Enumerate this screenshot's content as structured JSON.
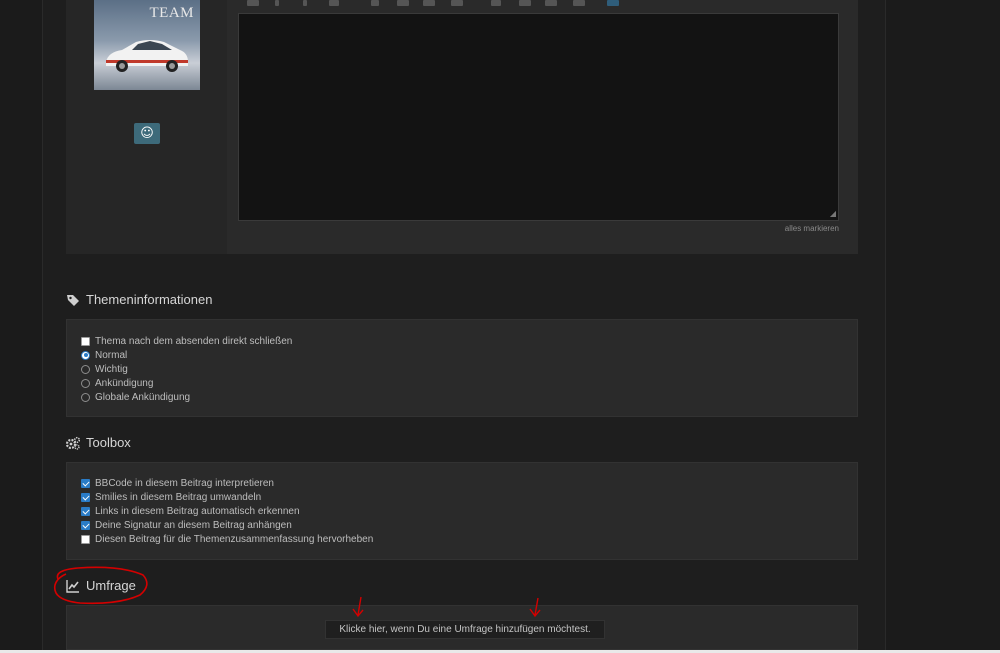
{
  "editor": {
    "avatar_text": "TEAM",
    "smiley_button": "☺",
    "select_all_link": "alles markieren"
  },
  "topic_info": {
    "heading": "Themeninformationen",
    "icon": "tag-icon",
    "options": [
      {
        "label": "Thema nach dem absenden direkt schließen",
        "type": "checkbox",
        "checked": false
      },
      {
        "label": "Normal",
        "type": "radio",
        "checked": true
      },
      {
        "label": "Wichtig",
        "type": "radio",
        "checked": false
      },
      {
        "label": "Ankündigung",
        "type": "radio",
        "checked": false
      },
      {
        "label": "Globale Ankündigung",
        "type": "radio",
        "checked": false
      }
    ]
  },
  "toolbox": {
    "heading": "Toolbox",
    "icon": "cogs-icon",
    "options": [
      {
        "label": "BBCode in diesem Beitrag interpretieren",
        "checked": true
      },
      {
        "label": "Smilies in diesem Beitrag umwandeln",
        "checked": true
      },
      {
        "label": "Links in diesem Beitrag automatisch erkennen",
        "checked": true
      },
      {
        "label": "Deine Signatur an diesem Beitrag anhängen",
        "checked": true
      },
      {
        "label": "Diesen Beitrag für die Themenzusammenfassung hervorheben",
        "checked": false
      }
    ]
  },
  "poll": {
    "heading": "Umfrage",
    "icon": "line-chart-icon",
    "add_button": "Klicke hier, wenn Du eine Umfrage hinzufügen möchtest."
  },
  "colors": {
    "accent": "#2a7cc7",
    "annotation": "#d40000"
  }
}
